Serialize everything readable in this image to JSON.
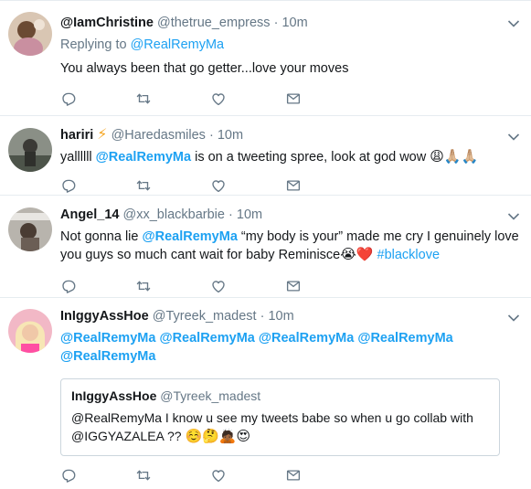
{
  "tweets": [
    {
      "name": "@IamChristine",
      "handle": "@thetrue_empress",
      "time": "10m",
      "reply_prefix": "Replying to",
      "reply_to": "@RealRemyMa",
      "text": "You always been that go getter...love your moves"
    },
    {
      "name": "hariri",
      "badge": "⚡",
      "handle": "@Haredasmiles",
      "time": "10m",
      "text_before": "yallllll ",
      "mention": "@RealRemyMa",
      "text_after": " is on a tweeting spree, look at god wow ",
      "emoji": "😩🙏🏼🙏🏼"
    },
    {
      "name": "Angel_14",
      "handle": "@xx_blackbarbie",
      "time": "10m",
      "text_before": "Not gonna lie ",
      "mention": "@RealRemyMa",
      "text_after": " “my body is your” made me cry I genuinely love you guys so much cant wait for baby Reminisce",
      "emoji": "😭❤️",
      "hashtag": "#blacklove"
    },
    {
      "name": "InIggyAssHoe",
      "handle": "@Tyreek_madest",
      "time": "10m",
      "mentions": [
        "@RealRemyMa",
        "@RealRemyMa",
        "@RealRemyMa",
        "@RealRemyMa",
        "@RealRemyMa"
      ],
      "quote": {
        "name": "InIggyAssHoe",
        "handle": "@Tyreek_madest",
        "text": "@RealRemyMa I know u see my tweets babe so when u go collab with @IGGYAZALEA ?? ",
        "emoji": "☺️🤔🙇🏾😍"
      }
    }
  ],
  "dot": "·",
  "icons": [
    "reply-icon",
    "retweet-icon",
    "like-icon",
    "direct-message-icon",
    "chevron-down-icon"
  ],
  "colors": {
    "link": "#1da1f2",
    "muted": "#657786",
    "border": "#e6ecf0",
    "heart": "#e0245e"
  }
}
